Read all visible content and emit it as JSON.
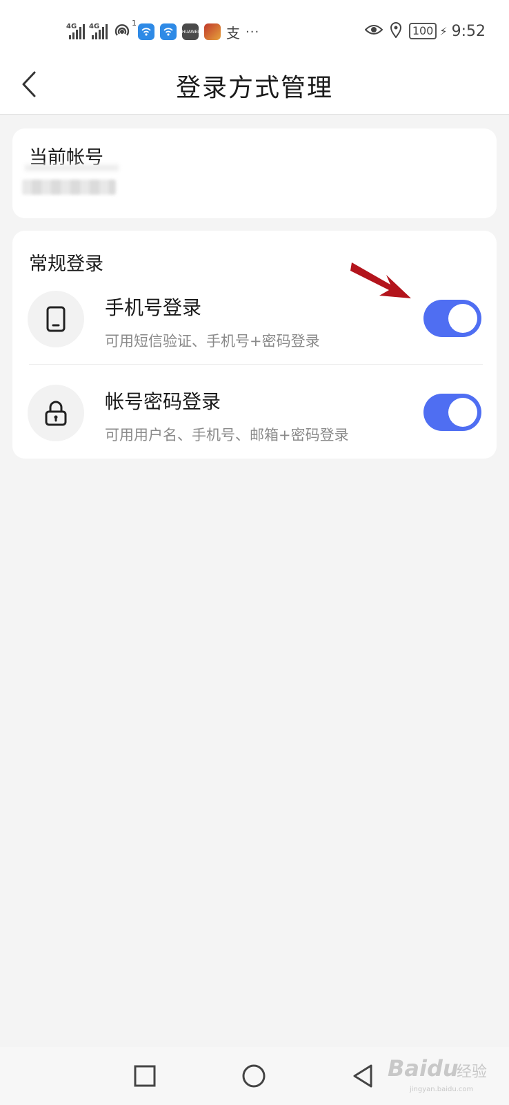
{
  "status_bar": {
    "net1": "4G",
    "net2": "4G",
    "hotspot_count": "1",
    "app_huawei": "HUAWEI",
    "app_text": "支",
    "more": "···",
    "battery": "100",
    "time": "9:52"
  },
  "header": {
    "title": "登录方式管理"
  },
  "account": {
    "label": "当前帐号"
  },
  "login_methods": {
    "section_title": "常规登录",
    "items": [
      {
        "title": "手机号登录",
        "desc": "可用短信验证、手机号+密码登录",
        "enabled": true,
        "icon": "phone-icon"
      },
      {
        "title": "帐号密码登录",
        "desc": "可用用户名、手机号、邮箱+密码登录",
        "enabled": true,
        "icon": "lock-icon"
      }
    ]
  },
  "colors": {
    "toggle_on": "#4f6ef2",
    "annotation_arrow": "#b3141c",
    "background": "#f4f4f4"
  },
  "watermark": {
    "brand": "Baidu",
    "jingyan": "经验",
    "url": "jingyan.baidu.com"
  }
}
